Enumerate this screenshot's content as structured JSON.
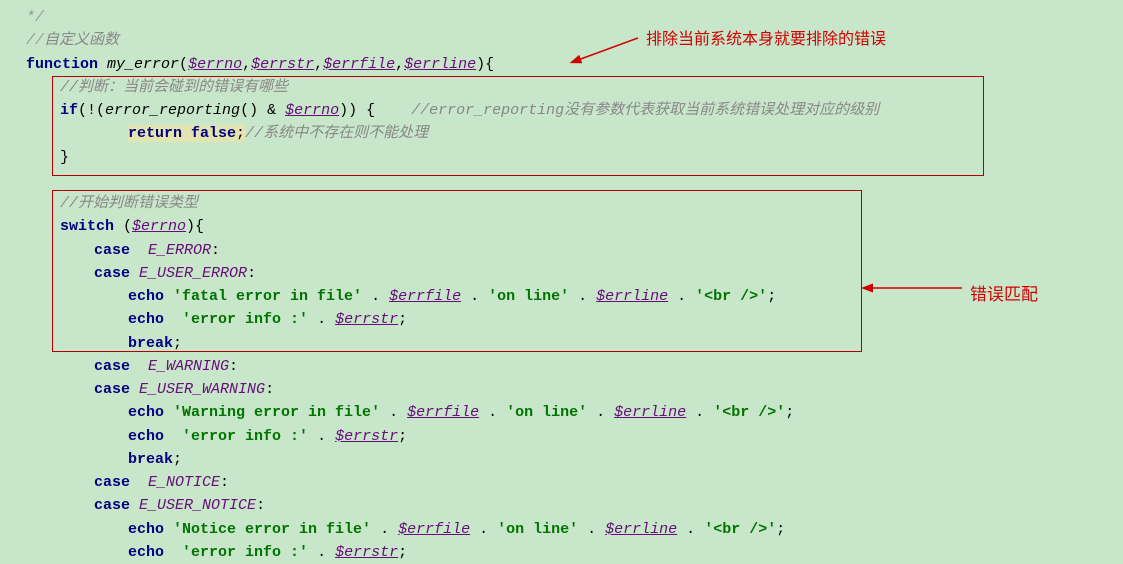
{
  "annotations": {
    "top": "排除当前系统本身就要排除的错误",
    "right": "错误匹配"
  },
  "code": {
    "l0": "*/",
    "l1_a": "//",
    "l1_b": "自定义函数",
    "l2_fn": "function",
    "l2_name": "my_error",
    "l2_p1": "$errno",
    "l2_p2": "$errstr",
    "l2_p3": "$errfile",
    "l2_p4": "$errline",
    "l3": "//判断：当前会碰到的错误有哪些",
    "l4_if": "if",
    "l4_call": "error_reporting",
    "l4_var": "$errno",
    "l4_cm": "//error_reporting没有参数代表获取当前系统错误处理对应的级别",
    "l5_ret": "return",
    "l5_false": "false",
    "l5_cm": "//系统中不存在则不能处理",
    "l7_cm": "//开始判断错误类型",
    "l8_sw": "switch",
    "l8_var": "$errno",
    "case": "case",
    "echo": "echo",
    "break": "break",
    "c_error": "E_ERROR",
    "c_uerror": "E_USER_ERROR",
    "c_warning": "E_WARNING",
    "c_uwarning": "E_USER_WARNING",
    "c_notice": "E_NOTICE",
    "c_unotice": "E_USER_NOTICE",
    "s_fatal": "'fatal error in file'",
    "s_warning": "'Warning error in file'",
    "s_notice": "'Notice error in file'",
    "s_online": "'on line'",
    "s_br": "'<br />'",
    "s_info": "'error info :'",
    "v_file": "$errfile",
    "v_line": "$errline",
    "v_str": "$errstr"
  }
}
